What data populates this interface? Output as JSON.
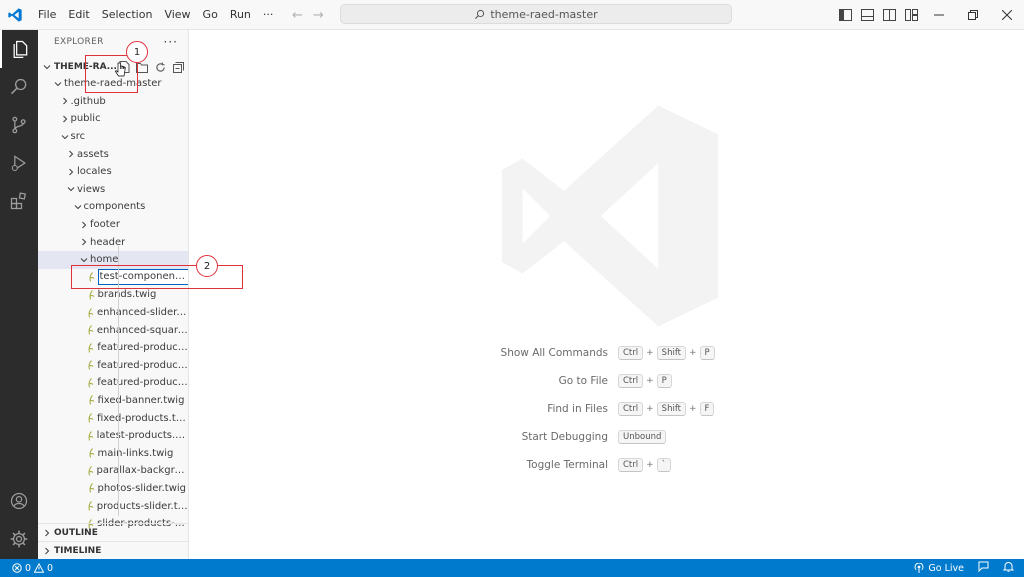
{
  "titlebar": {
    "menu": [
      "File",
      "Edit",
      "Selection",
      "View",
      "Go",
      "Run",
      "···"
    ],
    "search_text": "theme-raed-master"
  },
  "sidebar": {
    "header": "EXPLORER",
    "section_title": "THEME-RA...",
    "tree": [
      {
        "label": "theme-raed-master",
        "depth": 0,
        "type": "folder",
        "expanded": true
      },
      {
        "label": ".github",
        "depth": 1,
        "type": "folder",
        "expanded": false
      },
      {
        "label": "public",
        "depth": 1,
        "type": "folder",
        "expanded": false
      },
      {
        "label": "src",
        "depth": 1,
        "type": "folder",
        "expanded": true
      },
      {
        "label": "assets",
        "depth": 2,
        "type": "folder",
        "expanded": false
      },
      {
        "label": "locales",
        "depth": 2,
        "type": "folder",
        "expanded": false
      },
      {
        "label": "views",
        "depth": 2,
        "type": "folder",
        "expanded": true
      },
      {
        "label": "components",
        "depth": 3,
        "type": "folder",
        "expanded": true
      },
      {
        "label": "footer",
        "depth": 4,
        "type": "folder",
        "expanded": false
      },
      {
        "label": "header",
        "depth": 4,
        "type": "folder",
        "expanded": false
      },
      {
        "label": "home",
        "depth": 4,
        "type": "folder",
        "expanded": true,
        "selected": true
      },
      {
        "label": "test-component.twi",
        "depth": 5,
        "type": "file",
        "editing": true
      },
      {
        "label": "brands.twig",
        "depth": 5,
        "type": "file"
      },
      {
        "label": "enhanced-slider.t...",
        "depth": 5,
        "type": "file"
      },
      {
        "label": "enhanced-square...",
        "depth": 5,
        "type": "file"
      },
      {
        "label": "featured-product...",
        "depth": 5,
        "type": "file"
      },
      {
        "label": "featured-product...",
        "depth": 5,
        "type": "file"
      },
      {
        "label": "featured-product...",
        "depth": 5,
        "type": "file"
      },
      {
        "label": "fixed-banner.twig",
        "depth": 5,
        "type": "file"
      },
      {
        "label": "fixed-products.twig",
        "depth": 5,
        "type": "file"
      },
      {
        "label": "latest-products.tw...",
        "depth": 5,
        "type": "file"
      },
      {
        "label": "main-links.twig",
        "depth": 5,
        "type": "file"
      },
      {
        "label": "parallax-backgrou...",
        "depth": 5,
        "type": "file"
      },
      {
        "label": "photos-slider.twig",
        "depth": 5,
        "type": "file"
      },
      {
        "label": "products-slider.tw...",
        "depth": 5,
        "type": "file"
      },
      {
        "label": "slider-products-w...",
        "depth": 5,
        "type": "file"
      }
    ],
    "outline": "OUTLINE",
    "timeline": "TIMELINE"
  },
  "editor": {
    "shortcuts": [
      {
        "label": "Show All Commands",
        "keys": [
          "Ctrl",
          "Shift",
          "P"
        ]
      },
      {
        "label": "Go to File",
        "keys": [
          "Ctrl",
          "P"
        ]
      },
      {
        "label": "Find in Files",
        "keys": [
          "Ctrl",
          "Shift",
          "F"
        ]
      },
      {
        "label": "Start Debugging",
        "keys": [
          "Unbound"
        ]
      },
      {
        "label": "Toggle Terminal",
        "keys": [
          "Ctrl",
          "`"
        ]
      }
    ]
  },
  "statusbar": {
    "errors": "0",
    "warnings": "0",
    "go_live": "Go Live"
  },
  "annotations": {
    "marker_1": "1",
    "marker_2": "2",
    "color": "#e0303a"
  },
  "colors": {
    "activitybar": "#2c2c2c",
    "statusbar": "#007acc",
    "twig_icon": "#a3a93a"
  }
}
